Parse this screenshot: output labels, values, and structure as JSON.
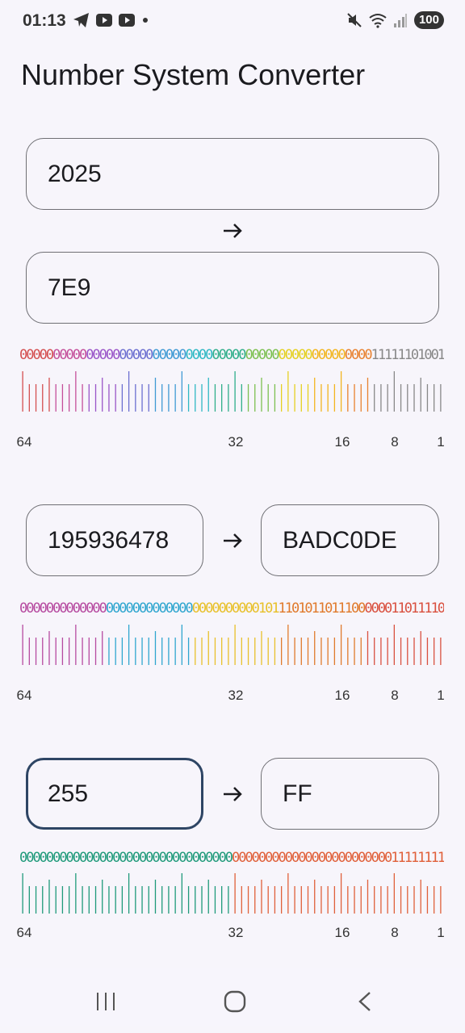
{
  "status": {
    "time": "01:13",
    "battery": "100",
    "icons_left": [
      "telegram-icon",
      "youtube-icon",
      "youtube-icon",
      "dot-icon"
    ],
    "icons_right": [
      "mute-icon",
      "wifi-icon",
      "signal-icon"
    ]
  },
  "app": {
    "title": "Number System Converter"
  },
  "converters": [
    {
      "input_value": "2025",
      "output_value": "7E9",
      "bits": "0000000000000000000000000000000000000000000000000000011111101001",
      "scale_labels": [
        "64",
        "32",
        "16",
        "8",
        "1"
      ],
      "colors": [
        "#d44f50",
        "#c44f9a",
        "#9a55c8",
        "#6c6fd0",
        "#3f9ad4",
        "#2fb8c4",
        "#2fae8a",
        "#7cc050",
        "#e5d020",
        "#f2b51e",
        "#e8822f",
        "#888888"
      ]
    },
    {
      "input_value": "195936478",
      "output_value": "BADC0DE",
      "bits": "0000000000000000000000000000000000001011101011011100000011011110",
      "scale_labels": [
        "64",
        "32",
        "16",
        "8",
        "1"
      ],
      "colors": [
        "#b64aa0",
        "#2fa6cf",
        "#e8c02a",
        "#e07a2c",
        "#d9503f"
      ]
    },
    {
      "input_value": "255",
      "output_value": "FF",
      "bits": "0000000000000000000000000000000000000000000000000000000011111111",
      "scale_labels": [
        "64",
        "32",
        "16",
        "8",
        "1"
      ],
      "colors": [
        "#1f9a7a",
        "#e0603a"
      ]
    }
  ],
  "nav": {
    "icons": [
      "recents-icon",
      "home-icon",
      "back-icon"
    ]
  }
}
